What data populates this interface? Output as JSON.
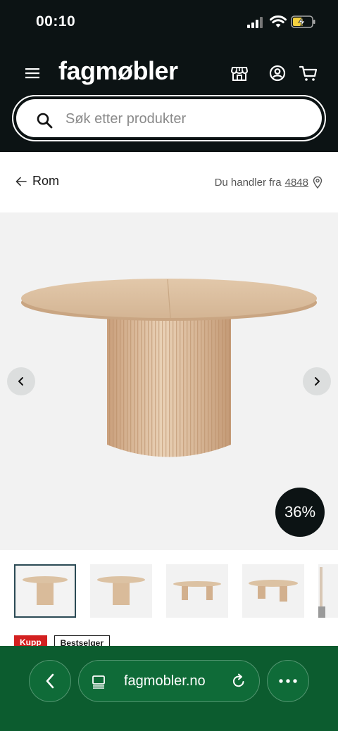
{
  "status_bar": {
    "time": "00:10",
    "icons": [
      "signal-icon",
      "wifi-icon",
      "battery-charging-icon"
    ]
  },
  "header": {
    "logo": "fagmøbler",
    "icons": [
      "menu-icon",
      "store-icon",
      "account-icon",
      "cart-icon"
    ],
    "search": {
      "placeholder": "Søk etter produkter",
      "value": ""
    }
  },
  "subnav": {
    "back_label": "Rom",
    "location_prefix": "Du handler fra",
    "postal_code": "4848"
  },
  "gallery": {
    "discount_badge": "36%",
    "thumbnail_count_visible": 5,
    "active_thumbnail": 1
  },
  "tags": {
    "kupp": "Kupp",
    "bestseller": "Bestselger"
  },
  "browser": {
    "url": "fagmobler.no",
    "icons": [
      "back-icon",
      "tabs-icon",
      "reload-icon",
      "more-icon"
    ]
  },
  "colors": {
    "header_bg": "#0c1314",
    "browser_bar_bg": "#0c5c2f",
    "kupp_red": "#d32020",
    "gallery_bg": "#f2f2f2"
  }
}
